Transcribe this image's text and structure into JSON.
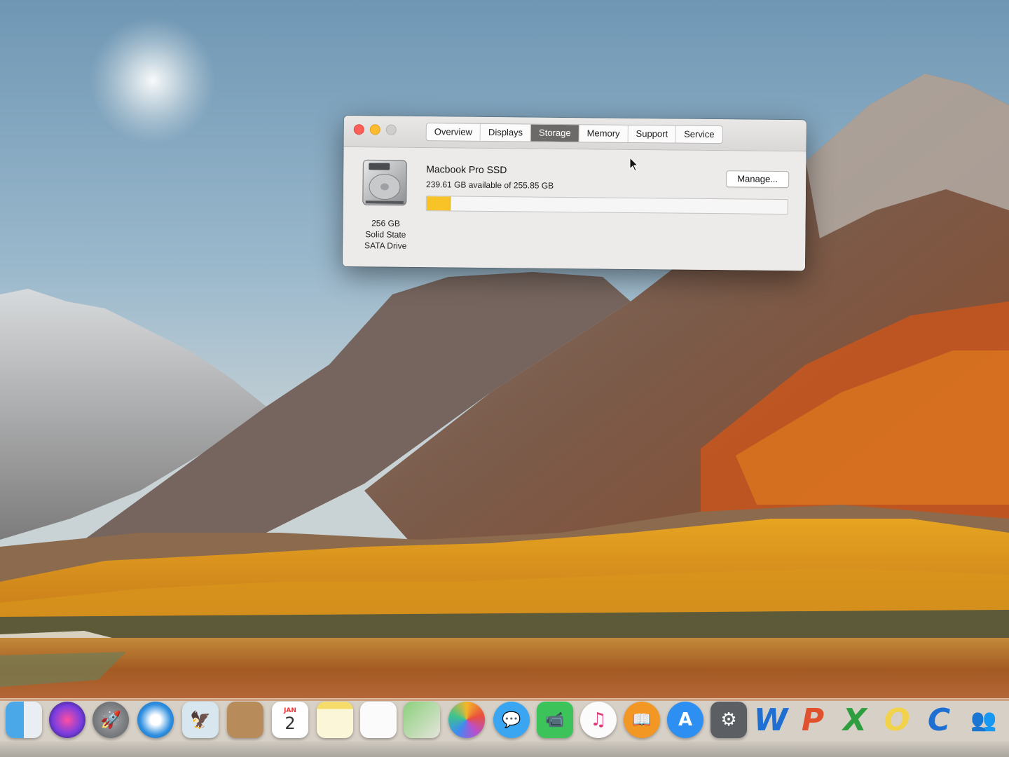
{
  "window": {
    "tabs": [
      {
        "label": "Overview"
      },
      {
        "label": "Displays"
      },
      {
        "label": "Storage"
      },
      {
        "label": "Memory"
      },
      {
        "label": "Support"
      },
      {
        "label": "Service"
      }
    ],
    "selected_tab": "Storage"
  },
  "storage": {
    "drive_name": "Macbook Pro SSD",
    "availability": "239.61 GB available of 255.85 GB",
    "capacity_label": "256 GB",
    "type_label": "Solid State",
    "interface_label": "SATA Drive",
    "manage_label": "Manage...",
    "used_fraction": 0.0635,
    "used_color": "#f7c327"
  },
  "dock": {
    "items": [
      {
        "icon": "finder-icon"
      },
      {
        "icon": "siri-icon"
      },
      {
        "icon": "launchpad-icon"
      },
      {
        "icon": "safari-icon"
      },
      {
        "icon": "mail-icon"
      },
      {
        "icon": "contacts-icon"
      },
      {
        "icon": "calendar-icon",
        "month": "JAN",
        "day": "2"
      },
      {
        "icon": "notes-icon"
      },
      {
        "icon": "reminders-icon"
      },
      {
        "icon": "maps-icon"
      },
      {
        "icon": "photos-icon"
      },
      {
        "icon": "messages-icon"
      },
      {
        "icon": "facetime-icon"
      },
      {
        "icon": "itunes-icon"
      },
      {
        "icon": "ibooks-icon"
      },
      {
        "icon": "app-store-icon"
      },
      {
        "icon": "system-preferences-icon"
      },
      {
        "icon": "word-icon",
        "glyph": "W"
      },
      {
        "icon": "powerpoint-icon",
        "glyph": "P"
      },
      {
        "icon": "excel-icon",
        "glyph": "X"
      },
      {
        "icon": "outlook-icon",
        "glyph": "O"
      },
      {
        "icon": "c-app-icon",
        "glyph": "C"
      },
      {
        "icon": "lync-icon"
      }
    ]
  }
}
